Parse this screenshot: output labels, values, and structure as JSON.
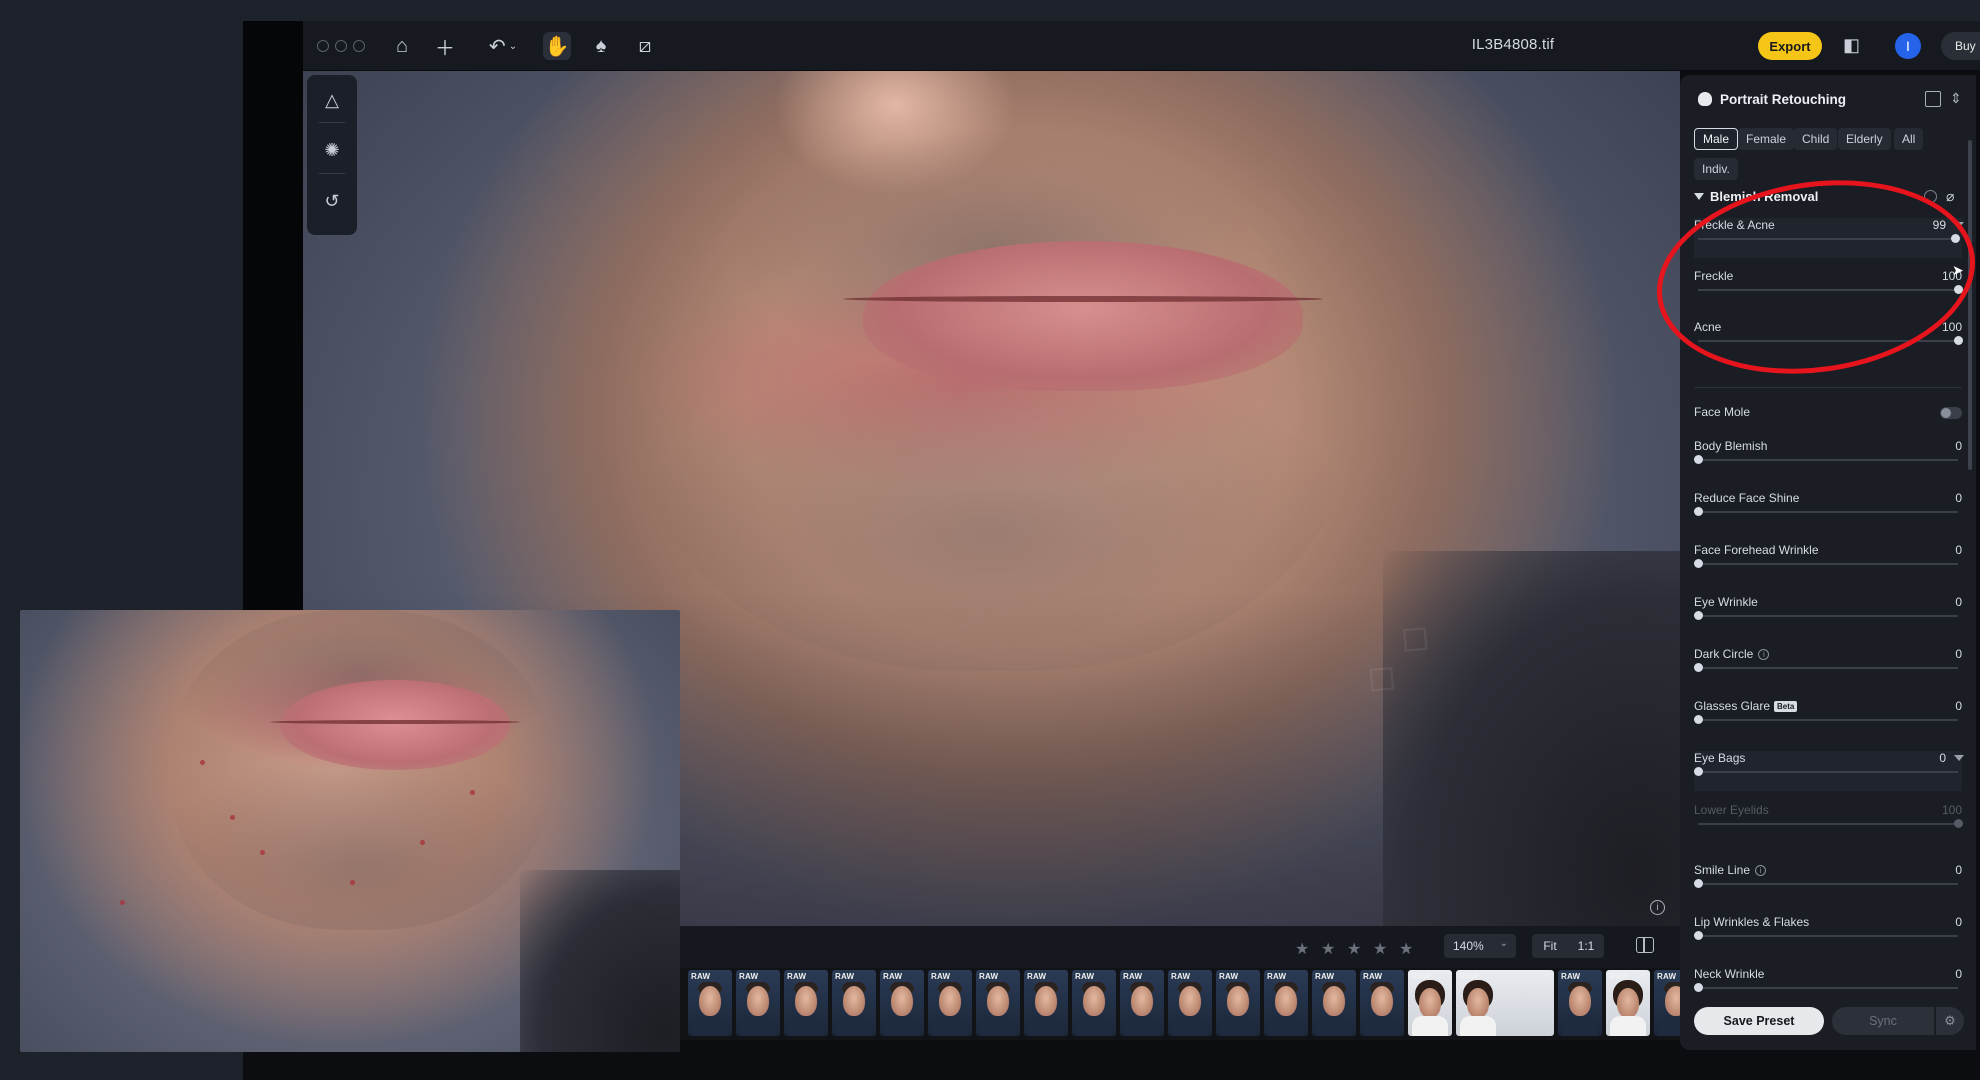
{
  "window": {
    "file_name": "IL3B4808.tif",
    "export_label": "Export",
    "avatar_initial": "I",
    "buy_label": "Buy N",
    "accent_color": "#f5c518",
    "avatar_color": "#2563eb"
  },
  "toolbar_icons": [
    "home-icon",
    "plus-icon",
    "undo-icon",
    "hand-icon",
    "brush-icon",
    "bandage-icon"
  ],
  "tool_palette_icons": [
    "adjust-icon",
    "texture-icon",
    "history-icon"
  ],
  "bottom_bar": {
    "rating_stars": 5,
    "zoom_value": "140%",
    "fit_label": "Fit",
    "one_to_one_label": "1:1"
  },
  "filmstrip": {
    "raw_badge": "RAW",
    "thumbnail_count": 21,
    "selected_index": 20
  },
  "panel": {
    "title": "Portrait Retouching",
    "chips": [
      {
        "label": "Male",
        "active": true
      },
      {
        "label": "Female",
        "active": false
      },
      {
        "label": "Child",
        "active": false
      },
      {
        "label": "Elderly",
        "active": false
      },
      {
        "label": "All",
        "active": false
      },
      {
        "label": "Indiv.",
        "active": false
      }
    ],
    "section_title": "Blemish Removal",
    "sliders": {
      "freckle_acne": {
        "label": "Freckle & Acne",
        "value": "99",
        "level": 0.99
      },
      "freckle": {
        "label": "Freckle",
        "value": "100",
        "level": 1.0
      },
      "acne": {
        "label": "Acne",
        "value": "100",
        "level": 1.0
      },
      "face_mole": {
        "label": "Face Mole",
        "toggle": false
      },
      "body_blemish": {
        "label": "Body Blemish",
        "value": "0",
        "level": 0
      },
      "reduce_face_shine": {
        "label": "Reduce Face Shine",
        "value": "0",
        "level": 0
      },
      "face_forehead_wrinkle": {
        "label": "Face Forehead Wrinkle",
        "value": "0",
        "level": 0
      },
      "eye_wrinkle": {
        "label": "Eye Wrinkle",
        "value": "0",
        "level": 0
      },
      "dark_circle": {
        "label": "Dark Circle",
        "value": "0",
        "level": 0
      },
      "glasses_glare": {
        "label": "Glasses Glare",
        "badge": "Beta",
        "value": "0",
        "level": 0
      },
      "eye_bags": {
        "label": "Eye Bags",
        "value": "0",
        "level": 0
      },
      "lower_eyelids": {
        "label": "Lower Eyelids",
        "value": "100",
        "level": 1.0
      },
      "smile_line": {
        "label": "Smile Line",
        "value": "0",
        "level": 0
      },
      "lip_wrinkles": {
        "label": "Lip Wrinkles & Flakes",
        "value": "0",
        "level": 0
      },
      "neck_wrinkle": {
        "label": "Neck Wrinkle",
        "value": "0",
        "level": 0
      }
    },
    "save_preset_label": "Save Preset",
    "sync_label": "Sync"
  },
  "annotation_color": "#e6141c"
}
